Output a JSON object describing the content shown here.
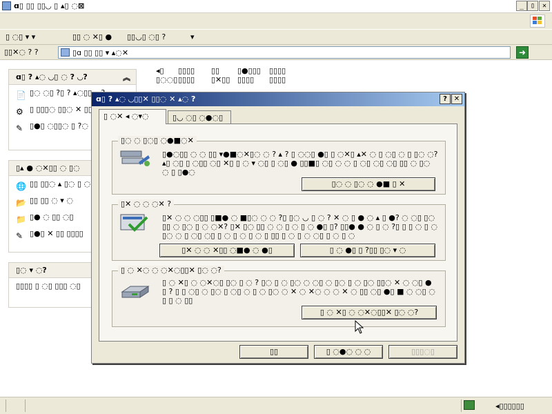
{
  "window": {
    "title": "ɑ▯ ▯▯ ▯▯◡ ▯ ▴▯ ◌⊠",
    "buttons": {
      "minimize": "_",
      "maximize": "▯",
      "close": "✕"
    }
  },
  "menubar": {},
  "toolbar": {
    "items": [
      "▯ ◌▯ ▾ ▾",
      "▯▯ ◌ ✕▯ ●",
      "▯▯◡▯ ◌▯ ?",
      "▾"
    ]
  },
  "addressbar": {
    "label": "▯▯✕◌ ? ?",
    "value": "▯ɑ ▯▯ ▯▯ ▾ ▴◌✕"
  },
  "panes": [
    {
      "header": "ɑ▯ ? ▴◌ ◡▯ ◌ ? ◡?",
      "items": [
        {
          "text": "▯◌ ◌▯ ?▯ ? ▴◌▯▯◡ ?"
        },
        {
          "text": "▯ ▯▯▯◌ ▯▯◌ ✕ ▯▯✕▯◌ ◌ ◌"
        },
        {
          "text": "▯●▯ ◌▯▯◌ ▯ ?◌ ◌▴ ▯■"
        }
      ]
    },
    {
      "header": "▯▴ ● ◌✕▯▯ ◌ ▯◌",
      "items": [
        {
          "text": "▯▯ ▯▯◌ ▴ ▯◌ ▯ ◌?"
        },
        {
          "text": "▯▯ ▯▯ ◌ ▾ ◌"
        },
        {
          "text": "▯● ◌ ▯▯ ◌▯"
        },
        {
          "text": "▯●▯ ✕ ▯▯ ▯▯▯▯"
        }
      ]
    },
    {
      "header": "▯◌ ▾ ◌?",
      "items": [
        {
          "text": "▯▯▯▯ ▯ ◌▯ ▯▯▯ ◌▯"
        }
      ]
    }
  ],
  "content": {
    "items": [
      {
        "line1": "◂▯",
        "line2": "▯◌◌▯"
      },
      {
        "line1": "▯▯▯▯",
        "line2": "▯▯▯▯"
      },
      {
        "line1": "▯▯",
        "line2": "▯✕▯▯"
      },
      {
        "line1": "▯●▯▯▯",
        "line2": "▯▯▯▯"
      },
      {
        "line1": "▯▯▯▯",
        "line2": "▯▯▯▯"
      }
    ]
  },
  "dialog": {
    "title": "ɑ▯ ? ▴◌ ◡▯▯✕ ▯▯◌ ✕ ▴◌ ?",
    "help": "?",
    "close": "✕",
    "tabs": [
      {
        "label": "▯ ◌✕ ◂ ◌▾◌",
        "active": true
      },
      {
        "label": "▯◡ ◌▯ ◌●◌▯",
        "active": false
      }
    ],
    "groups": [
      {
        "label": "▯◌ ◌ ▯◌▯ ◌●■◌✕",
        "text": "▯●◌▯▯ ◌ ◌ ▯▯ ▾●■◌✕▯◌ ◌ ? ▴ ? ▯ ◌◌▯ ●▯ ▯ ◌✕▯ ▴✕ ◌ ▯ ◌▯ ◌ ▯ ▯◌ ◌? ▴▯ ◌▯ ▯ ◌▯▯ ◌▯ ✕▯ ▯ ◌ ▾ ◌▯ ▯ ◌▯ ● ▯▯■▯ ◌▯ ◌ ◌ ▯ ◌▯ ◌▯ ◌▯ ▯▯ ◌ ▯◌ ◌ ▯ ▯●◌",
        "button": "▯◌ ◌ ▯◌ ◌ ●■ ▯ ✕"
      },
      {
        "label": "▯✕ ◌ ◌ ◌✕ ?",
        "text": "▯✕ ◌ ◌ ◌▯▯ ▯■● ◌ ■▯◌ ◌ ◌ ?▯ ▯◌ ◡ ▯ ◌ ? ✕ ◌ ▯ ● ◌ ▴ ▯ ●? ◌ ◌▯ ▯◌ ▯▯ ◌ ▯◌ ▯ ◌ ◌✕? ▯✕ ▯◌ ▯▯ ◌ ◌ ▯ ◌ ▯ ◌ ●▯ ▯? ▯▯● ● ◌ ▯ ◌ ?▯ ▯ ▯ ◌ ▯ ◌ ▯◌ ◌ ▯ ◌▯ ◌▯ ▯ ◌ ▯ ◌ ▯ ◌ ▯ ▯▯ ▯ ◌ ▯ ◌ ◌▯ ▯ ◌ ▯ ◌",
        "buttons": [
          "▯✕ ◌ ◌ ✕▯▯ ◌■● ◌ ●▯",
          "▯ ◌ ●▯ ▯ ?▯▯ ▯◌ ▾ ◌"
        ]
      },
      {
        "label": "▯ ◌ ✕◌ ◌ ◌✕◌▯▯✕ ▯◌ ◌?",
        "text": "▯ ◌ ✕▯ ◌ ◌✕◌▯ ▯◌ ▯ ◌ ? ▯◌ ▯ ◌ ▯◌ ◌ ◌▯ ◌ ▯◌ ▯ ◌ ▯◌ ▯▯◌ ✕ ◌ ◌▯ ● ▯ ? ▯ ▯ ◌▯ ◌ ▯◌ ▯ ◌▯ ◌ ▯ ◌ ▯◌ ◌ ✕ ◌ ✕◌ ◌ ◌ ✕ ◌ ▯▯ ◌▯ ●▯ ■ ◌ ◌▯ ◌ ▯ ▯ ◌ ▯▯",
        "button": "▯ ◌ ✕▯ ◌ ◌✕◌▯▯✕ ▯◌ ◌?"
      }
    ],
    "footer_buttons": [
      {
        "label": "▯▯",
        "disabled": false
      },
      {
        "label": "▯ ◌●◌ ◌ ◌",
        "disabled": false
      },
      {
        "label": "▯▯▯◌▯",
        "disabled": true
      }
    ]
  },
  "statusbar": {
    "right_text": "◂▯▯▯▯▯▯"
  }
}
